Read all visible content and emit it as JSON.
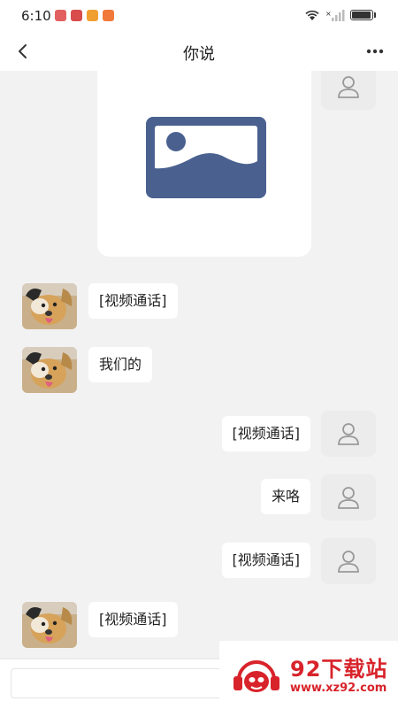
{
  "status_bar": {
    "time": "6:10",
    "icons": [
      "notification-app-icon",
      "book-app-icon",
      "character-app-icon",
      "character-app-icon"
    ],
    "right_icons": [
      "wifi-icon",
      "signal-icon",
      "battery-icon"
    ]
  },
  "header": {
    "title": "你说",
    "back_icon": "chevron-left-icon",
    "more_icon": "more-dots-icon"
  },
  "messages": [
    {
      "side": "right",
      "type": "image",
      "content": "image-placeholder"
    },
    {
      "side": "left",
      "type": "text",
      "text": "[视频通话]"
    },
    {
      "side": "left",
      "type": "text",
      "text": "我们的"
    },
    {
      "side": "right",
      "type": "text",
      "text": "[视频通话]"
    },
    {
      "side": "right",
      "type": "text",
      "text": "来咯"
    },
    {
      "side": "right",
      "type": "text",
      "text": "[视频通话]"
    },
    {
      "side": "left",
      "type": "text",
      "text": "[视频通话]"
    }
  ],
  "input": {
    "value": "",
    "placeholder": ""
  },
  "watermark": {
    "title": "92下载站",
    "url": "www.xz92.com"
  },
  "colors": {
    "background": "#f2f2f2",
    "bubble": "#ffffff",
    "image_icon": "#4a6190",
    "watermark_red": "#d8232a"
  }
}
